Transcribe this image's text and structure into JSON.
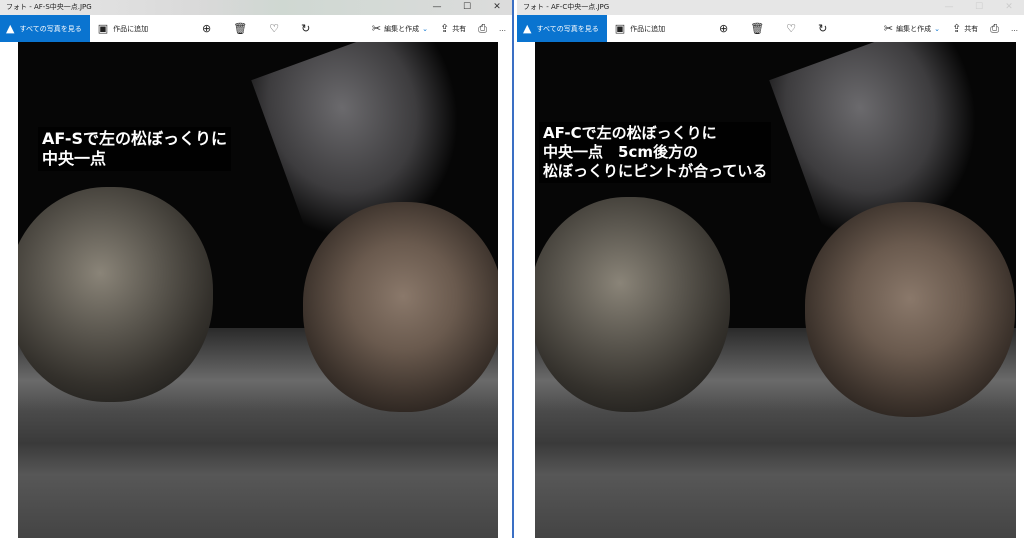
{
  "windows": [
    {
      "title": "フォト - AF-S中央一点.JPG",
      "toolbar": {
        "all_photos": "すべての写真を見る",
        "add_to_album": "作品に追加",
        "edit_create": "編集と作成",
        "share": "共有",
        "more": "…"
      },
      "caption": [
        "AF-Sで左の松ぼっくりに",
        "中央一点"
      ]
    },
    {
      "title": "フォト - AF-C中央一点.JPG",
      "toolbar": {
        "all_photos": "すべての写真を見る",
        "add_to_album": "作品に追加",
        "edit_create": "編集と作成",
        "share": "共有",
        "more": "…"
      },
      "caption": [
        "AF-Cで左の松ぼっくりに",
        "中央一点　5cm後方の",
        "松ぼっくりにピントが合っている"
      ]
    }
  ],
  "icons": {
    "minimize": "—",
    "maximize": "☐",
    "close": "✕",
    "zoom": "⊕",
    "delete": "🗑",
    "favorite": "♡",
    "rotate": "↻",
    "edit": "✂",
    "share": "⇪",
    "print": "⎙",
    "photos": "▲",
    "album": "▣",
    "chevron": "⌄"
  },
  "colors": {
    "accent": "#0a74d0"
  }
}
